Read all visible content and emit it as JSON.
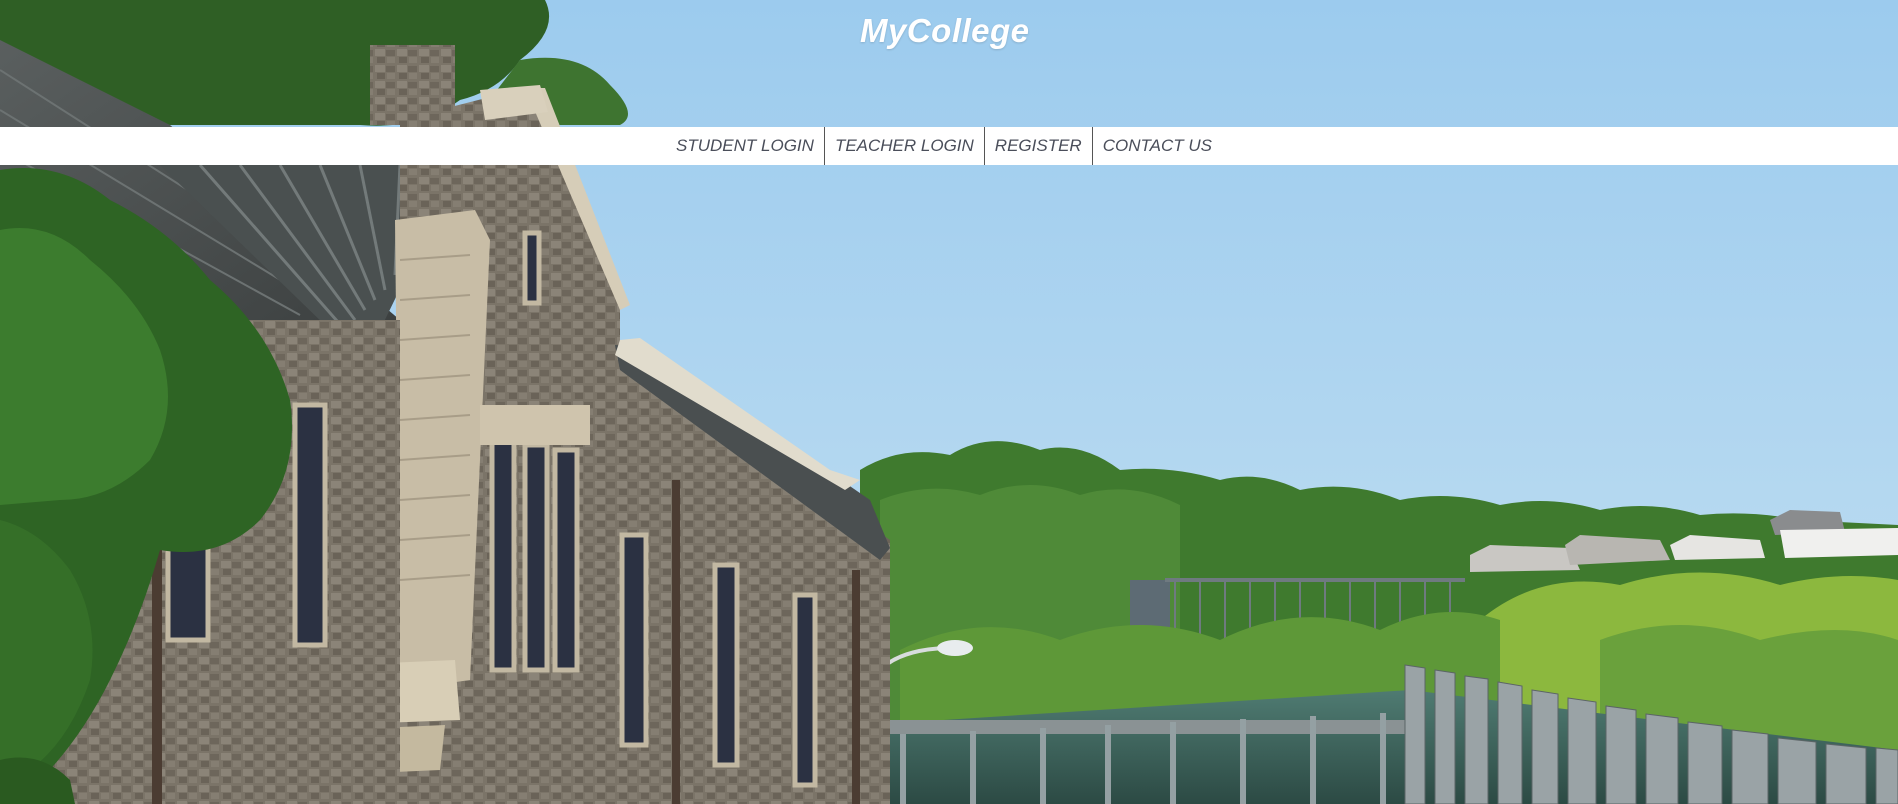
{
  "header": {
    "site_title": "MyCollege"
  },
  "nav": {
    "items": [
      {
        "label": "STUDENT LOGIN"
      },
      {
        "label": "TEACHER LOGIN"
      },
      {
        "label": "REGISTER"
      },
      {
        "label": "CONTACT US"
      }
    ]
  },
  "hero": {
    "description_icon": "campus-photo"
  },
  "colors": {
    "sky": "#a9d2ee",
    "nav_background": "#ffffff",
    "nav_text": "#4a4e5a",
    "title_text": "#ffffff"
  }
}
